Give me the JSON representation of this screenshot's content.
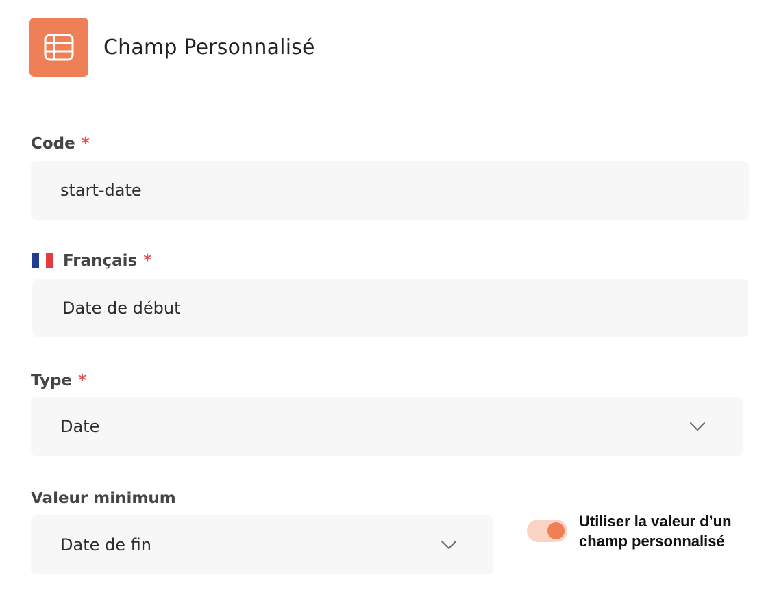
{
  "header": {
    "icon": "table-icon",
    "title": "Champ Personnalisé",
    "accent_color": "#ee7f56"
  },
  "code": {
    "label": "Code",
    "required_mark": "*",
    "value": "start-date"
  },
  "francais": {
    "flag": "flag-fr-icon",
    "label": "Français",
    "required_mark": "*",
    "value": "Date de début"
  },
  "type": {
    "label": "Type",
    "required_mark": "*",
    "value": "Date",
    "icon": "chevron-down-icon"
  },
  "valeur_minimum": {
    "label": "Valeur minimum",
    "value": "Date de fin",
    "icon": "chevron-down-icon"
  },
  "toggle": {
    "checked": true,
    "label": "Utiliser la valeur d’un champ personnalisé"
  }
}
